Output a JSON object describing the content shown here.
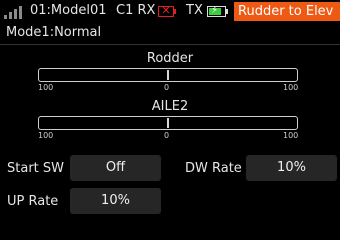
{
  "status": {
    "model": "01:Model01",
    "rx_label": "C1 RX",
    "rx_battery_icon": "battery-error-icon",
    "rx_battery_mark": "✕",
    "tx_label": "TX",
    "tx_battery_icon": "battery-charging-icon",
    "tx_battery_level": 0.8,
    "title": "Rudder to Elev",
    "accent_color": "#ee5a14"
  },
  "header": {
    "mode": "Mode1:Normal"
  },
  "channels": [
    {
      "label": "Rodder",
      "min": "100",
      "center": "0",
      "max": "100",
      "value": 0
    },
    {
      "label": "AILE2",
      "min": "100",
      "center": "0",
      "max": "100",
      "value": 0
    }
  ],
  "controls": {
    "start_sw_label": "Start SW",
    "start_sw_value": "Off",
    "dw_rate_label": "DW Rate",
    "dw_rate_value": "10%",
    "up_rate_label": "UP Rate",
    "up_rate_value": "10%"
  }
}
